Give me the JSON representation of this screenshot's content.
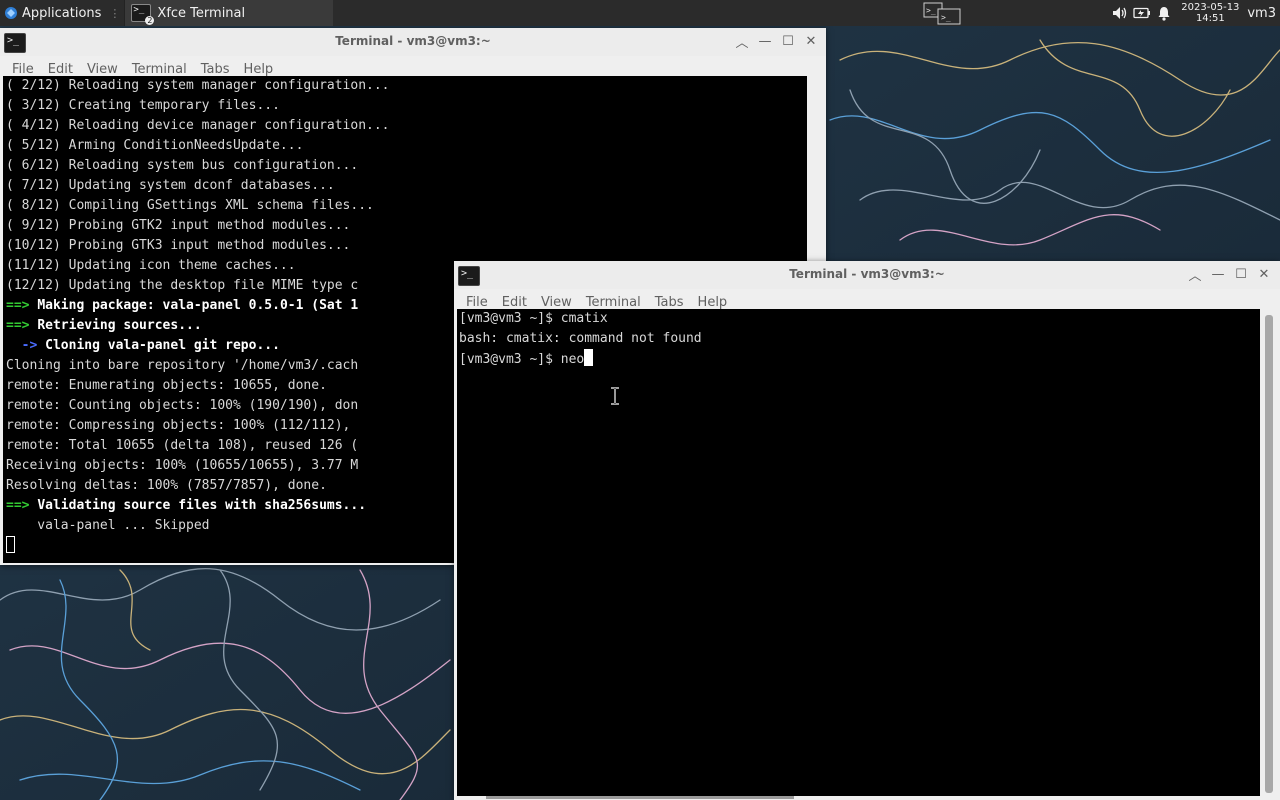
{
  "panel": {
    "applications_label": "Applications",
    "task_label": "Xfce Terminal",
    "task_badge": "2",
    "clock_date": "2023-05-13",
    "clock_time": "14:51",
    "user": "vm3"
  },
  "window_back": {
    "title": "Terminal - vm3@vm3:~",
    "menu": [
      "File",
      "Edit",
      "View",
      "Terminal",
      "Tabs",
      "Help"
    ],
    "lines": [
      [
        {
          "t": "( 2/12) Reloading system manager configuration...",
          "s": ""
        }
      ],
      [
        {
          "t": "( 3/12) Creating temporary files...",
          "s": ""
        }
      ],
      [
        {
          "t": "( 4/12) Reloading device manager configuration...",
          "s": ""
        }
      ],
      [
        {
          "t": "( 5/12) Arming ConditionNeedsUpdate...",
          "s": ""
        }
      ],
      [
        {
          "t": "( 6/12) Reloading system bus configuration...",
          "s": ""
        }
      ],
      [
        {
          "t": "( 7/12) Updating system dconf databases...",
          "s": ""
        }
      ],
      [
        {
          "t": "( 8/12) Compiling GSettings XML schema files...",
          "s": ""
        }
      ],
      [
        {
          "t": "( 9/12) Probing GTK2 input method modules...",
          "s": ""
        }
      ],
      [
        {
          "t": "(10/12) Probing GTK3 input method modules...",
          "s": ""
        }
      ],
      [
        {
          "t": "(11/12) Updating icon theme caches...",
          "s": ""
        }
      ],
      [
        {
          "t": "(12/12) Updating the desktop file MIME type c",
          "s": ""
        }
      ],
      [
        {
          "t": "==> ",
          "s": "g"
        },
        {
          "t": "Making package: vala-panel 0.5.0-1 (Sat 1",
          "s": "b"
        }
      ],
      [
        {
          "t": "==> ",
          "s": "g"
        },
        {
          "t": "Retrieving sources...",
          "s": "b"
        }
      ],
      [
        {
          "t": "  -> ",
          "s": "bl"
        },
        {
          "t": "Cloning vala-panel git repo...",
          "s": "b"
        }
      ],
      [
        {
          "t": "Cloning into bare repository '/home/vm3/.cach",
          "s": ""
        }
      ],
      [
        {
          "t": "remote: Enumerating objects: 10655, done.",
          "s": ""
        }
      ],
      [
        {
          "t": "remote: Counting objects: 100% (190/190), don",
          "s": ""
        }
      ],
      [
        {
          "t": "remote: Compressing objects: 100% (112/112), ",
          "s": ""
        }
      ],
      [
        {
          "t": "remote: Total 10655 (delta 108), reused 126 (",
          "s": ""
        }
      ],
      [
        {
          "t": "Receiving objects: 100% (10655/10655), 3.77 M",
          "s": ""
        }
      ],
      [
        {
          "t": "Resolving deltas: 100% (7857/7857), done.",
          "s": ""
        }
      ],
      [
        {
          "t": "==> ",
          "s": "g"
        },
        {
          "t": "Validating source files with sha256sums...",
          "s": "b"
        }
      ],
      [
        {
          "t": "    vala-panel ... Skipped",
          "s": ""
        }
      ]
    ]
  },
  "window_front": {
    "title": "Terminal - vm3@vm3:~",
    "menu": [
      "File",
      "Edit",
      "View",
      "Terminal",
      "Tabs",
      "Help"
    ],
    "lines": [
      "[vm3@vm3 ~]$ cmatix",
      "bash: cmatix: command not found",
      "[vm3@vm3 ~]$ neo"
    ]
  },
  "icons": {
    "applications": "xfce-mouse-icon",
    "terminal": "terminal-icon",
    "volume": "volume-icon",
    "battery": "battery-icon",
    "notifications": "bell-icon",
    "minimize": "minimize-icon",
    "maximize": "maximize-icon",
    "close": "close-icon",
    "shade": "shade-up-icon"
  },
  "colors": {
    "panel_bg": "#2b2b2b",
    "terminal_bg": "#000000",
    "terminal_fg": "#d8d8d8",
    "prompt_arrow": "#33cc33",
    "sub_arrow": "#4a6cff",
    "desktop_bg": "#1c2e3d"
  }
}
